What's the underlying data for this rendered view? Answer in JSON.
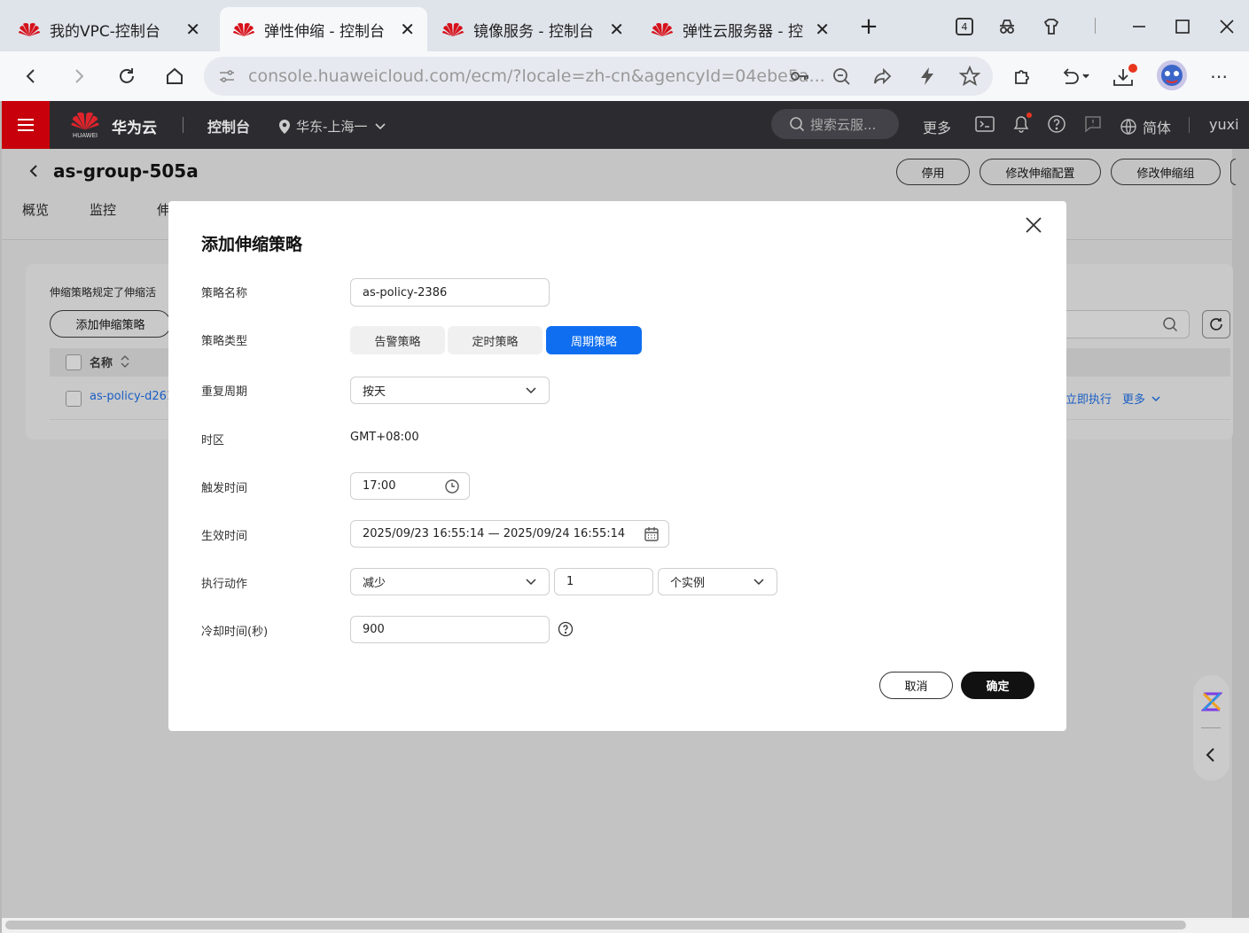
{
  "browser": {
    "tabs": [
      {
        "title": "我的VPC-控制台",
        "active": false
      },
      {
        "title": "弹性伸缩 - 控制台",
        "active": true
      },
      {
        "title": "镜像服务 - 控制台",
        "active": false
      },
      {
        "title": "弹性云服务器 - 控",
        "active": false
      }
    ],
    "new_tab": "+",
    "tab_count": "4",
    "url": "console.huaweicloud.com/ecm/?locale=zh-cn&agencyId=04ebe5a..."
  },
  "header": {
    "brand_small": "HUAWEI",
    "brand": "华为云",
    "console": "控制台",
    "region": "华东-上海一",
    "search_placeholder": "搜索云服...",
    "more": "更多",
    "lang": "简体",
    "user": "yuxi"
  },
  "page": {
    "title": "as-group-505a",
    "actions": {
      "disable": "停用",
      "edit_config": "修改伸缩配置",
      "edit_group": "修改伸缩组"
    },
    "tabs": [
      "概览",
      "监控",
      "伸"
    ],
    "desc": "伸缩策略规定了伸缩活",
    "add_policy": "添加伸缩策略",
    "col_name": "名称",
    "row_name": "as-policy-d261",
    "row_exec": "立即执行",
    "row_more": "更多"
  },
  "modal": {
    "title": "添加伸缩策略",
    "fields": {
      "name_label": "策略名称",
      "name_value": "as-policy-2386",
      "type_label": "策略类型",
      "types": [
        "告警策略",
        "定时策略",
        "周期策略"
      ],
      "selected_type": "周期策略",
      "repeat_label": "重复周期",
      "repeat_value": "按天",
      "tz_label": "时区",
      "tz_value": "GMT+08:00",
      "trigger_label": "触发时间",
      "trigger_value": "17:00",
      "effective_label": "生效时间",
      "effective_value": "2025/09/23 16:55:14 — 2025/09/24 16:55:14",
      "action_label": "执行动作",
      "action_value": "减少",
      "action_count": "1",
      "action_unit": "个实例",
      "cooldown_label": "冷却时间(秒)",
      "cooldown_value": "900"
    },
    "cancel": "取消",
    "confirm": "确定"
  },
  "colors": {
    "primary": "#0f6ef0",
    "brand_red": "#c7000b",
    "header_bg": "#2c2c30"
  }
}
